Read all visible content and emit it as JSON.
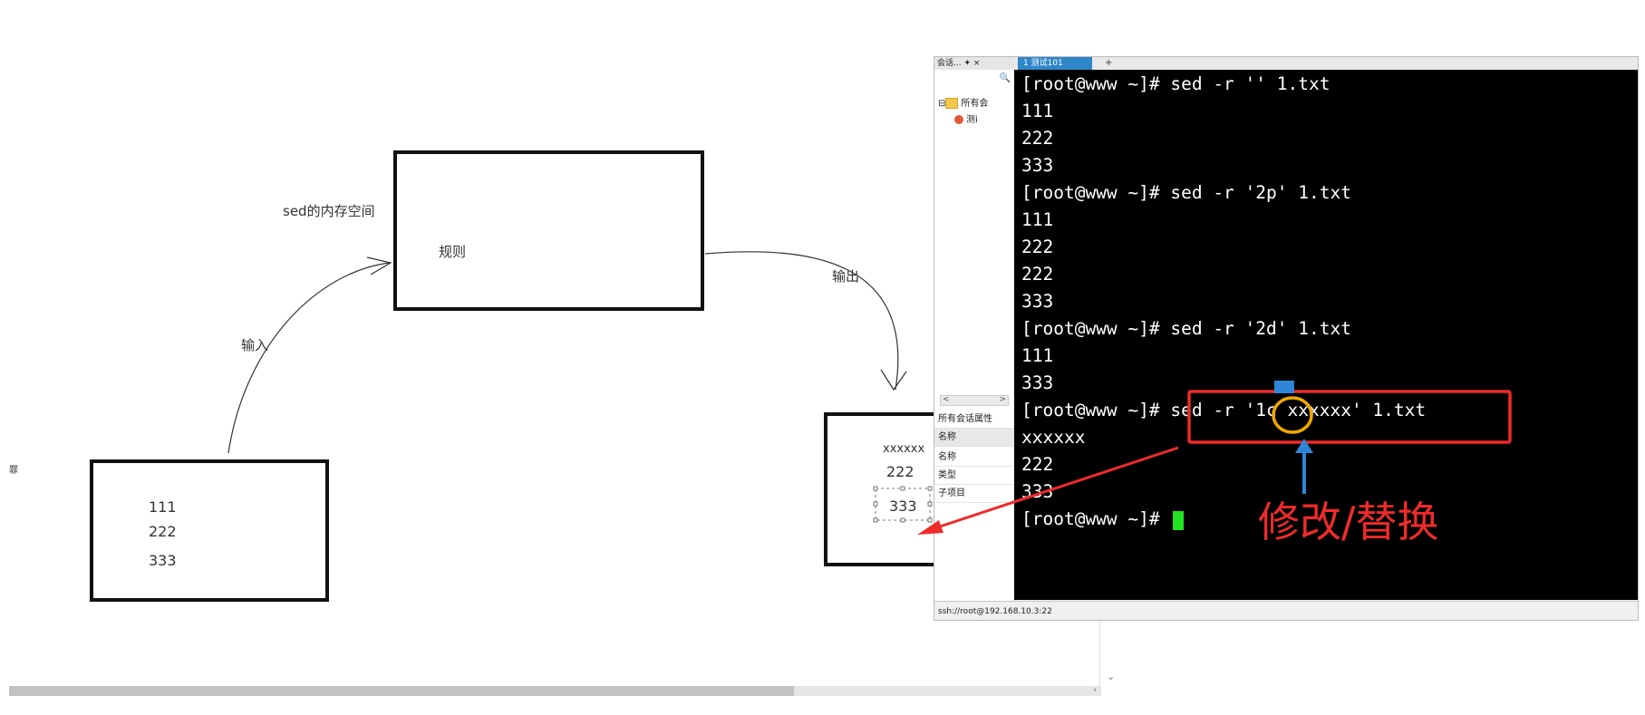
{
  "diagram": {
    "memory_label": "sed的内存空间",
    "rule_label": "规则",
    "input_label": "输入",
    "output_label": "输出",
    "left_edge_mark": "罪",
    "input_box_lines": [
      "111",
      "222",
      "333"
    ],
    "output_box_lines": [
      "xxxxxx",
      "222",
      "333"
    ]
  },
  "window": {
    "panel_header": "会话... ✦ ×",
    "search_icon": "search-icon",
    "tree": {
      "root_label": "所有会",
      "child_label": "测i"
    },
    "scroll_arrows": [
      "<",
      ">"
    ],
    "properties": {
      "title": "所有会话属性",
      "rows": [
        "名称",
        "名称",
        "类型",
        "子项目"
      ]
    },
    "tab_title": "1 测试101",
    "tab_add": "+",
    "status": "ssh://root@192.168.10.3:22"
  },
  "terminal": {
    "lines": [
      "[root@www ~]# sed -r '' 1.txt",
      "111",
      "222",
      "333",
      "[root@www ~]# sed -r '2p' 1.txt",
      "111",
      "222",
      "222",
      "333",
      "[root@www ~]# sed -r '2d' 1.txt",
      "111",
      "333",
      "[root@www ~]# sed -r '1c xxxxxx' 1.txt",
      "xxxxxx",
      "222",
      "333",
      "[root@www ~]# "
    ],
    "cursor_color": "#22e022"
  },
  "annotation": {
    "text": "修改/替换",
    "color": "#ee2b2b",
    "highlight_color": "#f0a800",
    "arrow_color": "#2f86d8"
  }
}
